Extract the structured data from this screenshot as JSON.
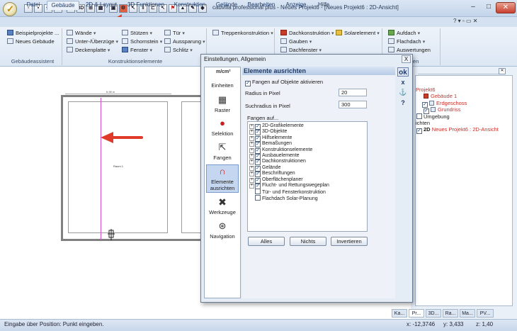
{
  "window": {
    "title": "cadvilla professional plus - Neues Projekt6 - [Neues Projekt6 : 2D-Ansicht]"
  },
  "quickaccess": [
    "2D",
    "3D"
  ],
  "tabs": [
    {
      "label": "Datei",
      "active": false
    },
    {
      "label": "Gebäude",
      "active": true
    },
    {
      "label": "2D & Layout",
      "active": false
    },
    {
      "label": "3D Funktionen",
      "active": false
    },
    {
      "label": "Konstruktion",
      "active": false
    },
    {
      "label": "Gelände",
      "active": false
    },
    {
      "label": "Bearbeiten",
      "active": false
    },
    {
      "label": "Anzeige",
      "active": false
    },
    {
      "label": "Hilfe",
      "active": false
    }
  ],
  "ribbon": {
    "gebaeudeassistent": {
      "label": "Gebäudeassistent",
      "items": [
        "Beispielprojekte ...",
        "Neues Gebäude"
      ]
    },
    "konstruktionselemente": {
      "label": "Konstruktionselemente",
      "col1": [
        "Wände",
        "Unter-/Überzüge",
        "Deckenplatte"
      ],
      "col2": [
        "Stützen",
        "Schornstein",
        "Fenster"
      ],
      "col3": [
        "Tür",
        "Aussparung",
        "Schlitz"
      ]
    },
    "treppen": {
      "items": [
        "Treppenkonstruktion"
      ]
    },
    "dach": {
      "items": [
        "Dachkonstruktion",
        "Gauben",
        "Dachfenster"
      ],
      "solar": "Solarelement"
    },
    "aufdach": {
      "items": [
        "Aufdach",
        "Flachdach",
        "Auswertungen"
      ],
      "label_partial": "gen"
    }
  },
  "dialog": {
    "title": "Einstellungen, Allgemein",
    "close": "X",
    "heading": "Elemente ausrichten",
    "categories": [
      "Einheiten",
      "Raster",
      "Selektion",
      "Fangen",
      "Elemente ausrichten",
      "Werkzeuge",
      "Navigation"
    ],
    "units_icon_text": "m/cm²",
    "fangen_aktiv": "Fangen auf Objekte aktivieren",
    "radius_label": "Radius in Pixel",
    "radius_value": "20",
    "suchradius_label": "Suchradius in Pixel",
    "suchradius_value": "300",
    "fangen_auf": "Fangen auf...",
    "list": [
      {
        "label": "2D-Grafikelemente",
        "checked": true,
        "expandable": true
      },
      {
        "label": "3D-Objekte",
        "checked": true,
        "expandable": true
      },
      {
        "label": "Hilfselemente",
        "checked": true,
        "expandable": true
      },
      {
        "label": "Bemaßungen",
        "checked": true,
        "expandable": true
      },
      {
        "label": "Konstruktionselemente",
        "checked": true,
        "expandable": true
      },
      {
        "label": "Ausbauelemente",
        "checked": true,
        "expandable": true
      },
      {
        "label": "Dachkonstruktionen",
        "checked": true,
        "expandable": true
      },
      {
        "label": "Gelände",
        "checked": true,
        "expandable": true
      },
      {
        "label": "Beschriftungen",
        "checked": true,
        "expandable": true
      },
      {
        "label": "Oberflächenplaner",
        "checked": true,
        "expandable": true
      },
      {
        "label": "Flucht- und Rettungswegeplan",
        "checked": true,
        "expandable": true
      },
      {
        "label": "Tür- und Fensterkonstruktion",
        "checked": false,
        "expandable": false
      },
      {
        "label": "Flachdach Solar-Planung",
        "checked": false,
        "expandable": false
      }
    ],
    "buttons": {
      "all": "Alles",
      "none": "Nichts",
      "invert": "Invertieren"
    },
    "tools": {
      "ok": "ok",
      "cancel": "x",
      "help": "?"
    }
  },
  "canvas": {
    "dim_label": "6,98 m",
    "room_label": "Raum 1"
  },
  "tree": {
    "items": [
      {
        "label": "Projekt6",
        "red": true,
        "indent": 0
      },
      {
        "label": "Gebäude 1",
        "red": true,
        "indent": 1
      },
      {
        "label": "Erdgeschoss",
        "red": true,
        "indent": 2
      },
      {
        "label": "Grundriss",
        "red": true,
        "indent": 3
      },
      {
        "label": "Umgebung",
        "red": false,
        "indent": 1
      },
      {
        "label": "ichten",
        "red": false,
        "indent": 0
      },
      {
        "label": "Neues Projekt6 : 2D-Ansicht",
        "red": true,
        "indent": 1,
        "prefix": "2D"
      }
    ]
  },
  "bottomtabs": [
    "Ka...",
    "Pr...",
    "3D...",
    "Ra...",
    "Ma...",
    "PV..."
  ],
  "status": {
    "text": "Eingabe über Position: Punkt eingeben.",
    "x": "x: -12,3746",
    "y": "y: 3,433",
    "z": "z: 1,40"
  }
}
